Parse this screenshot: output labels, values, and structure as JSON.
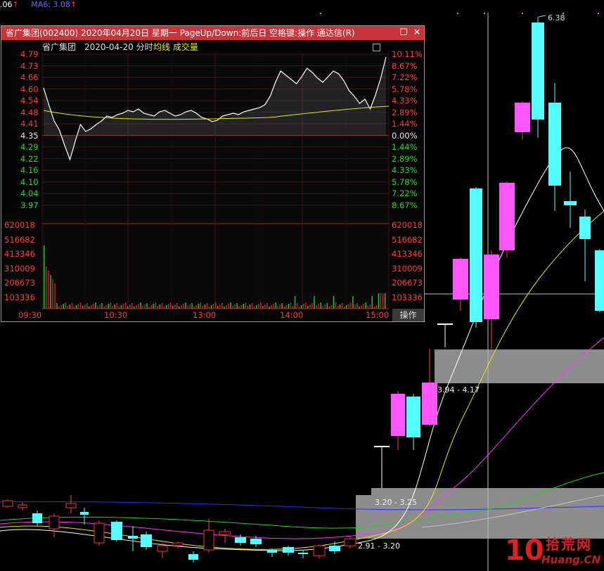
{
  "topbar": {
    "ma5_label": ".06",
    "ma6_label": "MA6: 3.08",
    "arrow": "↑"
  },
  "popup": {
    "title": "省广集团(002400) 2020年04月20日 星期一 PageUp/Down:前后日 空格键:操作 通达信(R)",
    "stock_name": "省广集团",
    "date": "2020-04-20",
    "mode": "分时",
    "avg_line_label": "均线",
    "volume_label": "成交量",
    "op_button": "操作",
    "price_labels": [
      "4.79",
      "4.73",
      "4.66",
      "4.60",
      "4.54",
      "4.48",
      "4.41",
      "4.35",
      "4.29",
      "4.22",
      "4.16",
      "4.10",
      "4.04",
      "3.97"
    ],
    "pct_labels": [
      "10.11%",
      "8.67%",
      "7.22%",
      "5.78%",
      "4.33%",
      "2.89%",
      "1.44%",
      "0.00%",
      "1.44%",
      "2.89%",
      "4.33%",
      "5.78%",
      "7.22%",
      "8.67%"
    ],
    "volume_labels": [
      "620018",
      "516682",
      "413346",
      "310009",
      "206673",
      "103336"
    ],
    "time_labels": [
      "09:30",
      "10:30",
      "13:00",
      "14:00",
      "15:00"
    ]
  },
  "zones": {
    "upper_label": "3.94 - 4.17",
    "mid_label": "3.20 - 3.25",
    "lower_label": "2.91 - 3.20"
  },
  "peak_label": "6.38",
  "watermark": {
    "brand_num": "10",
    "brand_cn": "拾荒网",
    "brand_en": "Huang.CN"
  },
  "colors": {
    "up": "#ff55ff",
    "down": "#55ffff",
    "zone": "#8c8c8c",
    "title_bar": "#c8343a"
  }
}
